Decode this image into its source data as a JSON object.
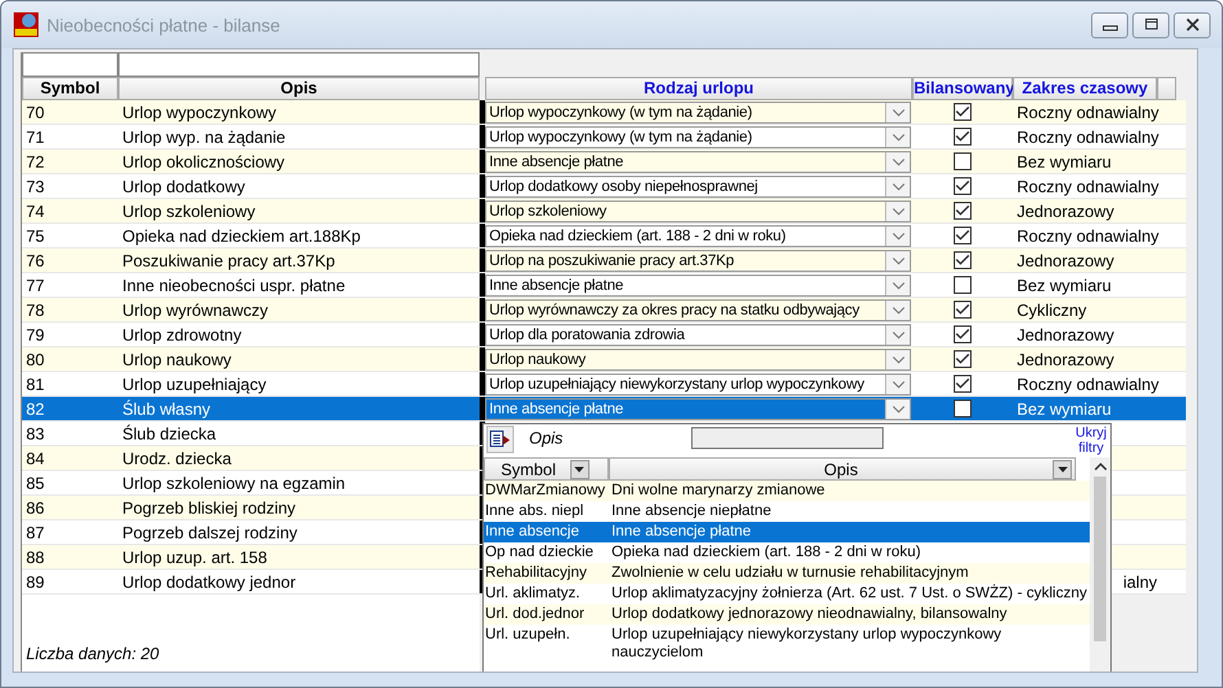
{
  "window": {
    "title": "Nieobecności płatne - bilanse"
  },
  "table": {
    "columns": [
      "Symbol",
      "Opis",
      "Rodzaj urlopu",
      "Bilansowany",
      "Zakres czasowy"
    ],
    "rows": [
      {
        "symbol": "70",
        "opis": "Urlop wypoczynkowy",
        "rodzaj": "Urlop wypoczynkowy (w tym na żądanie)",
        "bilansowany": true,
        "zakres": "Roczny odnawialny",
        "selected": false
      },
      {
        "symbol": "71",
        "opis": "Urlop wyp. na żądanie",
        "rodzaj": "Urlop wypoczynkowy (w tym na żądanie)",
        "bilansowany": true,
        "zakres": "Roczny odnawialny",
        "selected": false
      },
      {
        "symbol": "72",
        "opis": "Urlop okolicznościowy",
        "rodzaj": "Inne absencje płatne",
        "bilansowany": false,
        "zakres": "Bez wymiaru",
        "selected": false
      },
      {
        "symbol": "73",
        "opis": "Urlop dodatkowy",
        "rodzaj": "Urlop dodatkowy osoby niepełnosprawnej",
        "bilansowany": true,
        "zakres": "Roczny odnawialny",
        "selected": false
      },
      {
        "symbol": "74",
        "opis": "Urlop szkoleniowy",
        "rodzaj": "Urlop szkoleniowy",
        "bilansowany": true,
        "zakres": "Jednorazowy",
        "selected": false
      },
      {
        "symbol": "75",
        "opis": "Opieka nad dzieckiem art.188Kp",
        "rodzaj": "Opieka nad dzieckiem (art. 188 - 2 dni w roku)",
        "bilansowany": true,
        "zakres": "Roczny odnawialny",
        "selected": false
      },
      {
        "symbol": "76",
        "opis": "Poszukiwanie pracy art.37Kp",
        "rodzaj": "Urlop na poszukiwanie pracy art.37Kp",
        "bilansowany": true,
        "zakres": "Jednorazowy",
        "selected": false
      },
      {
        "symbol": "77",
        "opis": "Inne nieobecności uspr. płatne",
        "rodzaj": "Inne absencje płatne",
        "bilansowany": false,
        "zakres": "Bez wymiaru",
        "selected": false
      },
      {
        "symbol": "78",
        "opis": "Urlop wyrównawczy",
        "rodzaj": "Urlop wyrównawczy za okres pracy na statku odbywający",
        "bilansowany": true,
        "zakres": "Cykliczny",
        "selected": false
      },
      {
        "symbol": "79",
        "opis": "Urlop zdrowotny",
        "rodzaj": "Urlop dla poratowania zdrowia",
        "bilansowany": true,
        "zakres": "Jednorazowy",
        "selected": false
      },
      {
        "symbol": "80",
        "opis": "Urlop naukowy",
        "rodzaj": "Urlop naukowy",
        "bilansowany": true,
        "zakres": "Jednorazowy",
        "selected": false
      },
      {
        "symbol": "81",
        "opis": "Urlop uzupełniający",
        "rodzaj": "Urlop uzupełniający niewykorzystany urlop wypoczynkowy",
        "bilansowany": true,
        "zakres": "Roczny odnawialny",
        "selected": false
      },
      {
        "symbol": "82",
        "opis": "Ślub własny",
        "rodzaj": "Inne absencje płatne",
        "bilansowany": false,
        "zakres": "Bez wymiaru",
        "selected": true
      },
      {
        "symbol": "83",
        "opis": "Ślub dziecka",
        "selected": false
      },
      {
        "symbol": "84",
        "opis": "Urodz. dziecka",
        "selected": false
      },
      {
        "symbol": "85",
        "opis": "Urlop szkoleniowy na egzamin",
        "selected": false
      },
      {
        "symbol": "86",
        "opis": "Pogrzeb bliskiej rodziny",
        "selected": false
      },
      {
        "symbol": "87",
        "opis": "Pogrzeb dalszej rodziny",
        "selected": false
      },
      {
        "symbol": "88",
        "opis": "Urlop uzup. art. 158",
        "selected": false
      },
      {
        "symbol": "89",
        "opis": "Urlop dodatkowy jednor",
        "zakres": "ialny",
        "selected": false
      }
    ]
  },
  "status": "Liczba danych: 20",
  "dropdown": {
    "filter_label": "Opis",
    "hide_filters_link": "Ukryj filtry",
    "columns": [
      "Symbol",
      "Opis"
    ],
    "rows": [
      {
        "symbol": "DWMarZmianowy",
        "opis": "Dni wolne marynarzy zmianowe",
        "selected": false
      },
      {
        "symbol": "Inne abs. niepl",
        "opis": "Inne absencje niepłatne",
        "selected": false
      },
      {
        "symbol": "Inne absencje",
        "opis": "Inne absencje płatne",
        "selected": true
      },
      {
        "symbol": "Op nad dzieckie",
        "opis": "Opieka nad dzieckiem (art. 188 - 2 dni w roku)",
        "selected": false
      },
      {
        "symbol": "Rehabilitacyjny",
        "opis": "Zwolnienie w celu udziału w turnusie rehabilitacyjnym",
        "selected": false
      },
      {
        "symbol": "Url. aklimatyz.",
        "opis": "Urlop aklimatyzacyjny żołnierza (Art. 62 ust. 7 Ust. o SWŻZ) - cykliczny",
        "selected": false
      },
      {
        "symbol": "Url. dod.jednor",
        "opis": "Urlop dodatkowy jednorazowy nieodnawialny, bilansowalny",
        "selected": false
      },
      {
        "symbol": "Url. uzupełn.",
        "opis": "Urlop uzupełniający niewykorzystany urlop wypoczynkowy nauczycielom",
        "selected": false
      }
    ]
  }
}
